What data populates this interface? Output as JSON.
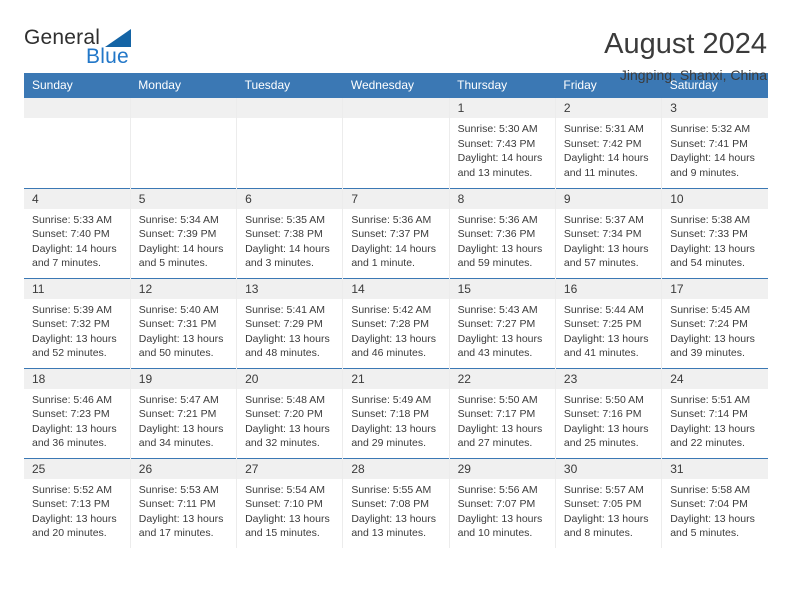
{
  "brand": {
    "name_part1": "General",
    "name_part2": "Blue",
    "triangle_color": "#1464a5",
    "blue_color": "#2277c8"
  },
  "header": {
    "title": "August 2024",
    "subtitle": "Jingping, Shanxi, China",
    "header_bg_color": "#3b78b4",
    "header_text_color": "#ffffff"
  },
  "weekday_headers": [
    "Sunday",
    "Monday",
    "Tuesday",
    "Wednesday",
    "Thursday",
    "Friday",
    "Saturday"
  ],
  "weeks": [
    [
      {
        "day": "",
        "empty": true
      },
      {
        "day": "",
        "empty": true
      },
      {
        "day": "",
        "empty": true
      },
      {
        "day": "",
        "empty": true
      },
      {
        "day": "1",
        "sunrise": "Sunrise: 5:30 AM",
        "sunset": "Sunset: 7:43 PM",
        "daylight": "Daylight: 14 hours and 13 minutes."
      },
      {
        "day": "2",
        "sunrise": "Sunrise: 5:31 AM",
        "sunset": "Sunset: 7:42 PM",
        "daylight": "Daylight: 14 hours and 11 minutes."
      },
      {
        "day": "3",
        "sunrise": "Sunrise: 5:32 AM",
        "sunset": "Sunset: 7:41 PM",
        "daylight": "Daylight: 14 hours and 9 minutes."
      }
    ],
    [
      {
        "day": "4",
        "sunrise": "Sunrise: 5:33 AM",
        "sunset": "Sunset: 7:40 PM",
        "daylight": "Daylight: 14 hours and 7 minutes."
      },
      {
        "day": "5",
        "sunrise": "Sunrise: 5:34 AM",
        "sunset": "Sunset: 7:39 PM",
        "daylight": "Daylight: 14 hours and 5 minutes."
      },
      {
        "day": "6",
        "sunrise": "Sunrise: 5:35 AM",
        "sunset": "Sunset: 7:38 PM",
        "daylight": "Daylight: 14 hours and 3 minutes."
      },
      {
        "day": "7",
        "sunrise": "Sunrise: 5:36 AM",
        "sunset": "Sunset: 7:37 PM",
        "daylight": "Daylight: 14 hours and 1 minute."
      },
      {
        "day": "8",
        "sunrise": "Sunrise: 5:36 AM",
        "sunset": "Sunset: 7:36 PM",
        "daylight": "Daylight: 13 hours and 59 minutes."
      },
      {
        "day": "9",
        "sunrise": "Sunrise: 5:37 AM",
        "sunset": "Sunset: 7:34 PM",
        "daylight": "Daylight: 13 hours and 57 minutes."
      },
      {
        "day": "10",
        "sunrise": "Sunrise: 5:38 AM",
        "sunset": "Sunset: 7:33 PM",
        "daylight": "Daylight: 13 hours and 54 minutes."
      }
    ],
    [
      {
        "day": "11",
        "sunrise": "Sunrise: 5:39 AM",
        "sunset": "Sunset: 7:32 PM",
        "daylight": "Daylight: 13 hours and 52 minutes."
      },
      {
        "day": "12",
        "sunrise": "Sunrise: 5:40 AM",
        "sunset": "Sunset: 7:31 PM",
        "daylight": "Daylight: 13 hours and 50 minutes."
      },
      {
        "day": "13",
        "sunrise": "Sunrise: 5:41 AM",
        "sunset": "Sunset: 7:29 PM",
        "daylight": "Daylight: 13 hours and 48 minutes."
      },
      {
        "day": "14",
        "sunrise": "Sunrise: 5:42 AM",
        "sunset": "Sunset: 7:28 PM",
        "daylight": "Daylight: 13 hours and 46 minutes."
      },
      {
        "day": "15",
        "sunrise": "Sunrise: 5:43 AM",
        "sunset": "Sunset: 7:27 PM",
        "daylight": "Daylight: 13 hours and 43 minutes."
      },
      {
        "day": "16",
        "sunrise": "Sunrise: 5:44 AM",
        "sunset": "Sunset: 7:25 PM",
        "daylight": "Daylight: 13 hours and 41 minutes."
      },
      {
        "day": "17",
        "sunrise": "Sunrise: 5:45 AM",
        "sunset": "Sunset: 7:24 PM",
        "daylight": "Daylight: 13 hours and 39 minutes."
      }
    ],
    [
      {
        "day": "18",
        "sunrise": "Sunrise: 5:46 AM",
        "sunset": "Sunset: 7:23 PM",
        "daylight": "Daylight: 13 hours and 36 minutes."
      },
      {
        "day": "19",
        "sunrise": "Sunrise: 5:47 AM",
        "sunset": "Sunset: 7:21 PM",
        "daylight": "Daylight: 13 hours and 34 minutes."
      },
      {
        "day": "20",
        "sunrise": "Sunrise: 5:48 AM",
        "sunset": "Sunset: 7:20 PM",
        "daylight": "Daylight: 13 hours and 32 minutes."
      },
      {
        "day": "21",
        "sunrise": "Sunrise: 5:49 AM",
        "sunset": "Sunset: 7:18 PM",
        "daylight": "Daylight: 13 hours and 29 minutes."
      },
      {
        "day": "22",
        "sunrise": "Sunrise: 5:50 AM",
        "sunset": "Sunset: 7:17 PM",
        "daylight": "Daylight: 13 hours and 27 minutes."
      },
      {
        "day": "23",
        "sunrise": "Sunrise: 5:50 AM",
        "sunset": "Sunset: 7:16 PM",
        "daylight": "Daylight: 13 hours and 25 minutes."
      },
      {
        "day": "24",
        "sunrise": "Sunrise: 5:51 AM",
        "sunset": "Sunset: 7:14 PM",
        "daylight": "Daylight: 13 hours and 22 minutes."
      }
    ],
    [
      {
        "day": "25",
        "sunrise": "Sunrise: 5:52 AM",
        "sunset": "Sunset: 7:13 PM",
        "daylight": "Daylight: 13 hours and 20 minutes."
      },
      {
        "day": "26",
        "sunrise": "Sunrise: 5:53 AM",
        "sunset": "Sunset: 7:11 PM",
        "daylight": "Daylight: 13 hours and 17 minutes."
      },
      {
        "day": "27",
        "sunrise": "Sunrise: 5:54 AM",
        "sunset": "Sunset: 7:10 PM",
        "daylight": "Daylight: 13 hours and 15 minutes."
      },
      {
        "day": "28",
        "sunrise": "Sunrise: 5:55 AM",
        "sunset": "Sunset: 7:08 PM",
        "daylight": "Daylight: 13 hours and 13 minutes."
      },
      {
        "day": "29",
        "sunrise": "Sunrise: 5:56 AM",
        "sunset": "Sunset: 7:07 PM",
        "daylight": "Daylight: 13 hours and 10 minutes."
      },
      {
        "day": "30",
        "sunrise": "Sunrise: 5:57 AM",
        "sunset": "Sunset: 7:05 PM",
        "daylight": "Daylight: 13 hours and 8 minutes."
      },
      {
        "day": "31",
        "sunrise": "Sunrise: 5:58 AM",
        "sunset": "Sunset: 7:04 PM",
        "daylight": "Daylight: 13 hours and 5 minutes."
      }
    ]
  ]
}
